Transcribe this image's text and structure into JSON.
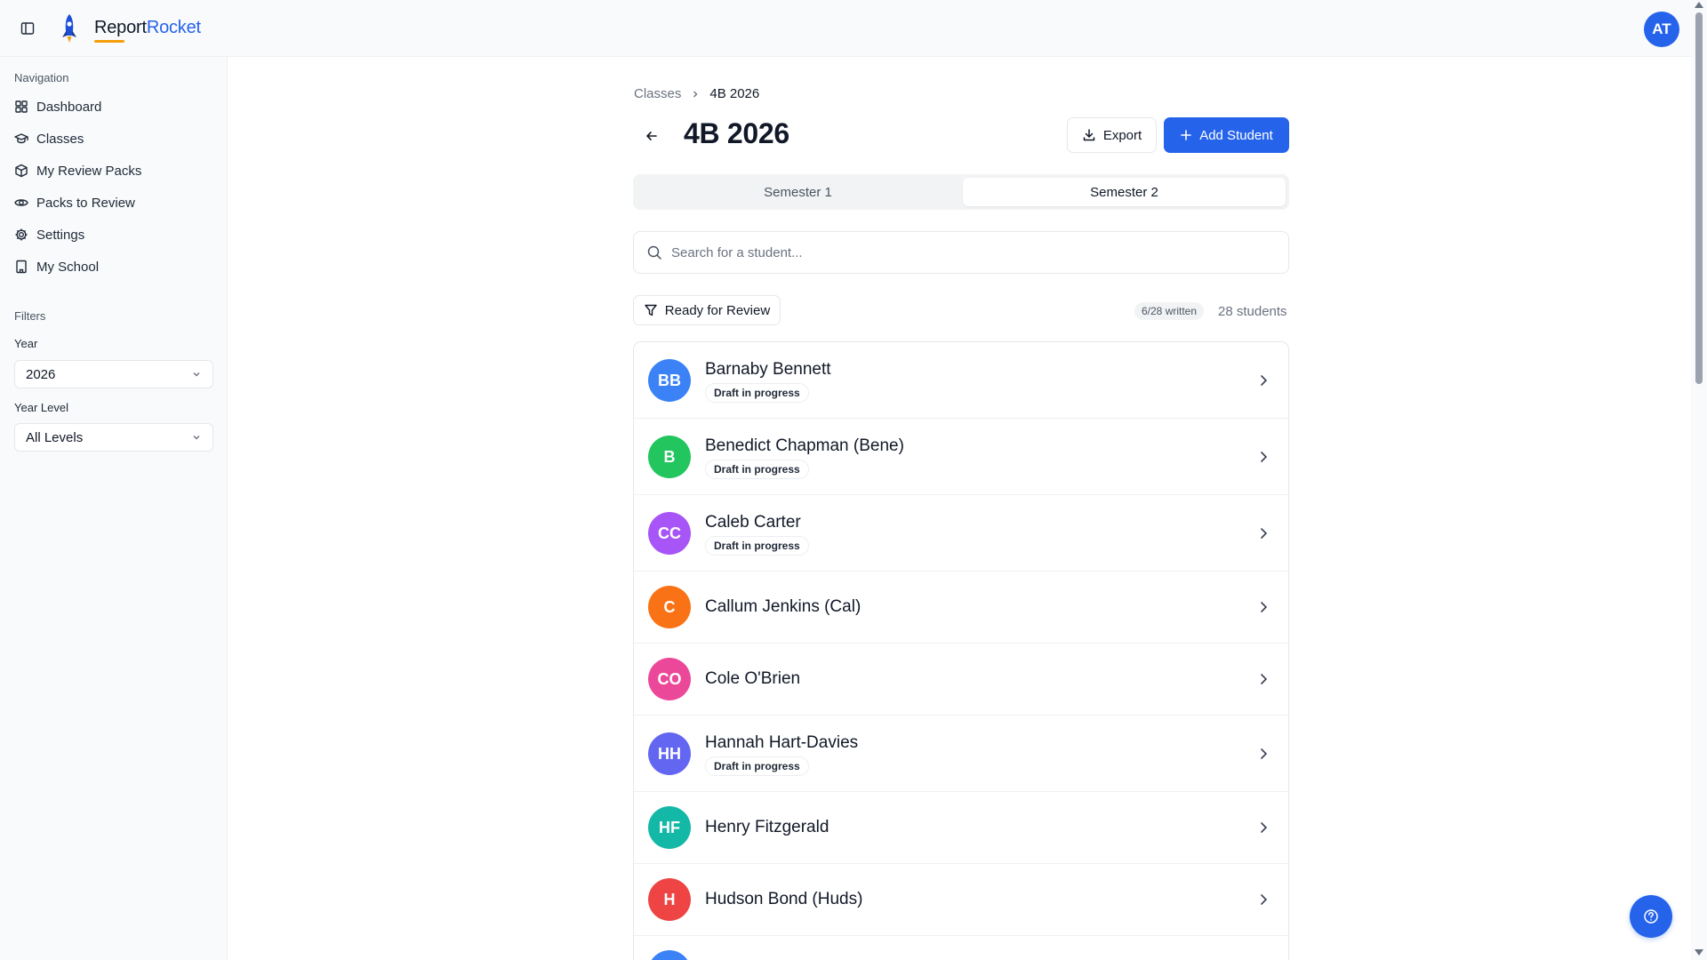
{
  "app": {
    "name_part1": "Report",
    "name_part2": "Rocket",
    "user_initials": "AT",
    "accent_color": "#2563eb"
  },
  "sidebar": {
    "nav_heading": "Navigation",
    "items": [
      {
        "label": "Dashboard",
        "icon": "grid-icon"
      },
      {
        "label": "Classes",
        "icon": "graduation-cap-icon"
      },
      {
        "label": "My Review Packs",
        "icon": "package-icon"
      },
      {
        "label": "Packs to Review",
        "icon": "eye-icon"
      },
      {
        "label": "Settings",
        "icon": "gear-icon"
      },
      {
        "label": "My School",
        "icon": "building-icon"
      }
    ],
    "filters_heading": "Filters",
    "year_label": "Year",
    "year_value": "2026",
    "year_level_label": "Year Level",
    "year_level_value": "All Levels"
  },
  "main": {
    "breadcrumb": {
      "parent": "Classes",
      "current": "4B 2026"
    },
    "title": "4B 2026",
    "export_label": "Export",
    "add_student_label": "Add Student",
    "tabs": [
      {
        "label": "Semester 1",
        "active": false
      },
      {
        "label": "Semester 2",
        "active": true
      }
    ],
    "search_placeholder": "Search for a student...",
    "filter_label": "Ready for Review",
    "written_badge": "6/28 written",
    "students_count": "28 students",
    "students": [
      {
        "initials": "BB",
        "name": "Barnaby Bennett",
        "status": "Draft in progress",
        "color": "#3b82f6"
      },
      {
        "initials": "B",
        "name": "Benedict Chapman (Bene)",
        "status": "Draft in progress",
        "color": "#22c55e"
      },
      {
        "initials": "CC",
        "name": "Caleb Carter",
        "status": "Draft in progress",
        "color": "#a855f7"
      },
      {
        "initials": "C",
        "name": "Callum Jenkins (Cal)",
        "status": "",
        "color": "#f97316"
      },
      {
        "initials": "CO",
        "name": "Cole O'Brien",
        "status": "",
        "color": "#ec4899"
      },
      {
        "initials": "HH",
        "name": "Hannah Hart-Davies",
        "status": "Draft in progress",
        "color": "#6366f1"
      },
      {
        "initials": "HF",
        "name": "Henry Fitzgerald",
        "status": "",
        "color": "#14b8a6"
      },
      {
        "initials": "H",
        "name": "Hudson Bond (Huds)",
        "status": "",
        "color": "#ef4444"
      },
      {
        "initials": "",
        "name": "",
        "status": "",
        "color": "#3b82f6"
      }
    ]
  }
}
